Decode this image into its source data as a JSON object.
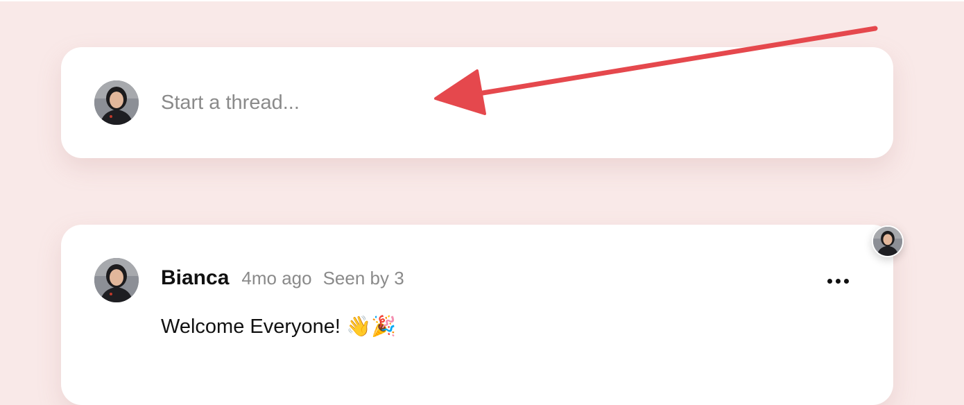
{
  "composer": {
    "placeholder": "Start a thread..."
  },
  "thread": {
    "author": "Bianca",
    "time_ago": "4mo ago",
    "seen_by": "Seen by 3",
    "message": "Welcome Everyone! 👋🎉",
    "more_icon": "more-horizontal-icon"
  },
  "colors": {
    "background": "#f9e9e8",
    "card": "#ffffff",
    "annotation_arrow": "#e5484d",
    "muted_text": "#8a8a8a"
  }
}
